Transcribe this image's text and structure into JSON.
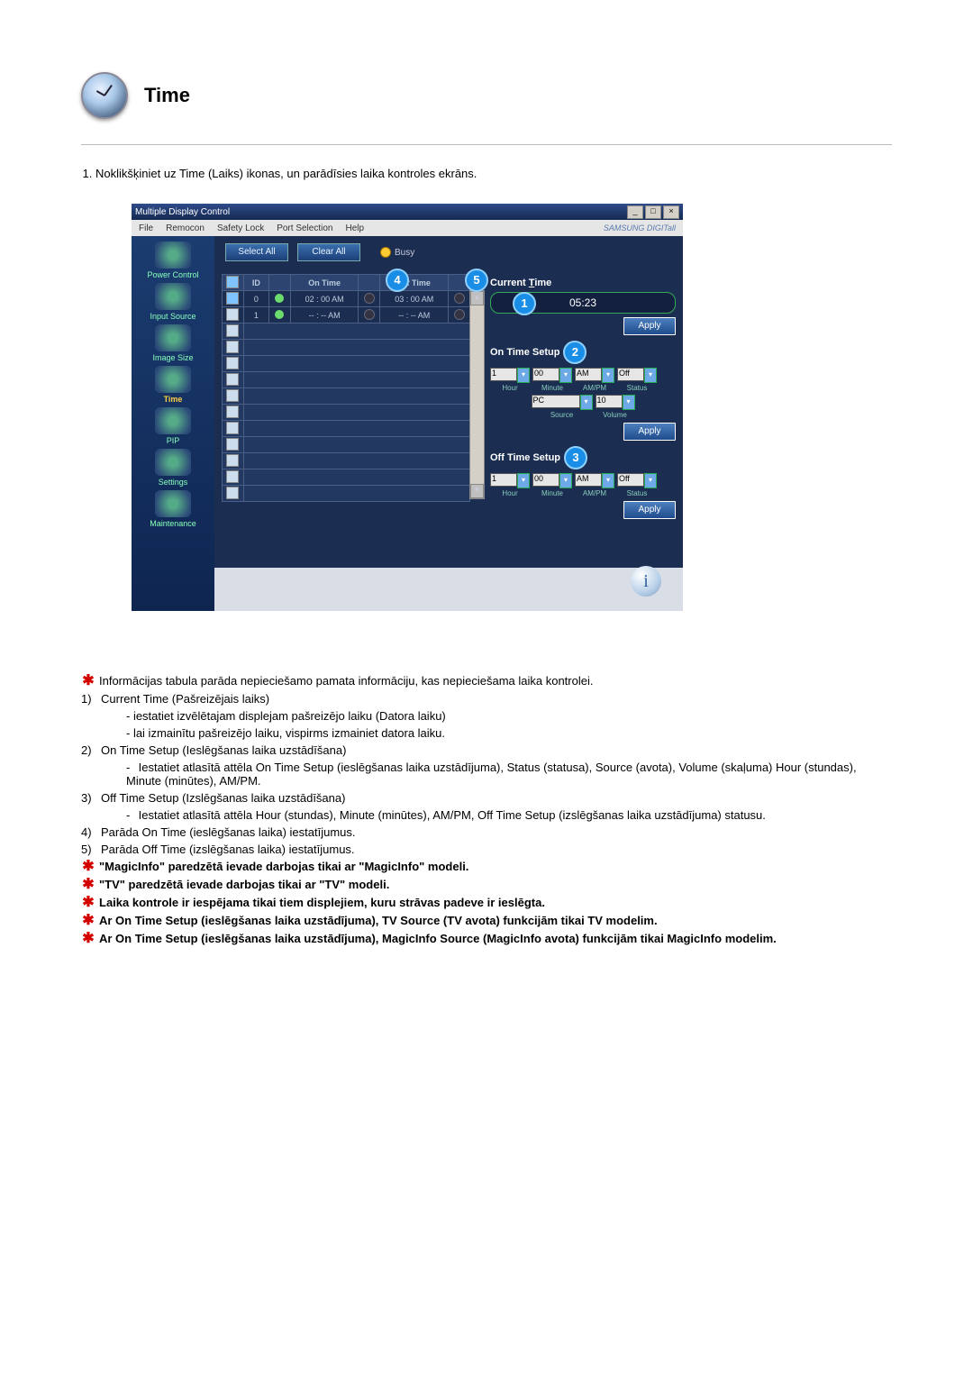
{
  "header": {
    "title": "Time"
  },
  "instruction": "Noklikšķiniet uz Time (Laiks) ikonas, un parādīsies laika kontroles ekrāns.",
  "app": {
    "title": "Multiple Display Control",
    "menu": [
      "File",
      "Remocon",
      "Safety Lock",
      "Port Selection",
      "Help"
    ],
    "brand": "SAMSUNG DIGITall",
    "sidebar": [
      {
        "label": "Power Control"
      },
      {
        "label": "Input Source"
      },
      {
        "label": "Image Size"
      },
      {
        "label": "Time",
        "selected": true
      },
      {
        "label": "PIP"
      },
      {
        "label": "Settings"
      },
      {
        "label": "Maintenance"
      }
    ],
    "buttons": {
      "selectAll": "Select All",
      "clearAll": "Clear All"
    },
    "busy": "Busy",
    "table": {
      "headers": [
        "",
        "ID",
        "",
        "On Time",
        "",
        "Off Time",
        ""
      ],
      "rows": [
        {
          "checked": true,
          "id": "0",
          "g1": true,
          "onTime": "02 : 00 AM",
          "g2": false,
          "offTime": "03 : 00 AM",
          "g3": false
        },
        {
          "checked": false,
          "id": "1",
          "g1": true,
          "onTime": "-- : -- AM",
          "g2": false,
          "offTime": "-- : -- AM",
          "g3": false
        }
      ]
    },
    "callouts": {
      "c1": "1",
      "c2": "2",
      "c3": "3",
      "c4": "4",
      "c5": "5"
    },
    "right": {
      "currentTime": {
        "title": "Current Time",
        "value": "05:23",
        "apply": "Apply"
      },
      "onTime": {
        "title": "On Time Setup",
        "hour": "1",
        "minute": "00",
        "ampm": "AM",
        "status": "Off",
        "hourL": "Hour",
        "minuteL": "Minute",
        "ampmL": "AM/PM",
        "statusL": "Status",
        "source": "PC",
        "volume": "10",
        "sourceL": "Source",
        "volumeL": "Volume",
        "apply": "Apply"
      },
      "offTime": {
        "title": "Off Time Setup",
        "hour": "1",
        "minute": "00",
        "ampm": "AM",
        "status": "Off",
        "hourL": "Hour",
        "minuteL": "Minute",
        "ampmL": "AM/PM",
        "statusL": "Status",
        "apply": "Apply"
      }
    }
  },
  "notes": {
    "intro": "Informācijas tabula parāda nepieciešamo pamata informāciju, kas nepieciešama laika kontrolei.",
    "items": [
      {
        "n": "1)",
        "t": "Current Time (Pašreizējais laiks)",
        "subs": [
          "- iestatiet izvēlētajam displejam pašreizējo laiku (Datora laiku)",
          "- lai izmainītu pašreizējo laiku, vispirms izmainiet datora laiku."
        ]
      },
      {
        "n": "2)",
        "t": "On Time Setup (Ieslēgšanas laika uzstādīšana)",
        "subs": [
          "Iestatiet atlasītā attēla On Time Setup (ieslēgšanas laika uzstādījuma), Status (statusa), Source (avota), Volume (skaļuma) Hour (stundas), Minute (minūtes), AM/PM."
        ],
        "dash": true
      },
      {
        "n": "3)",
        "t": "Off Time Setup (Izslēgšanas laika uzstādīšana)",
        "subs": [
          "Iestatiet atlasītā attēla Hour (stundas), Minute (minūtes), AM/PM, Off Time Setup (izslēgšanas laika uzstādījuma) statusu."
        ],
        "dash": true
      },
      {
        "n": "4)",
        "t": "Parāda On Time (ieslēgšanas laika) iestatījumus."
      },
      {
        "n": "5)",
        "t": "Parāda Off Time (izslēgšanas laika) iestatījumus."
      }
    ],
    "stars": [
      "\"MagicInfo\" paredzētā ievade darbojas tikai ar \"MagicInfo\" modeli.",
      "\"TV\" paredzētā ievade darbojas tikai ar \"TV\" modeli.",
      "Laika kontrole ir iespējama tikai tiem displejiem, kuru strāvas padeve ir ieslēgta.",
      "Ar On Time Setup (ieslēgšanas laika uzstādījuma), TV Source (TV avota) funkcijām tikai TV modelim.",
      "Ar On Time Setup (ieslēgšanas laika uzstādījuma), MagicInfo Source (MagicInfo avota) funkcijām tikai MagicInfo modelim."
    ]
  }
}
